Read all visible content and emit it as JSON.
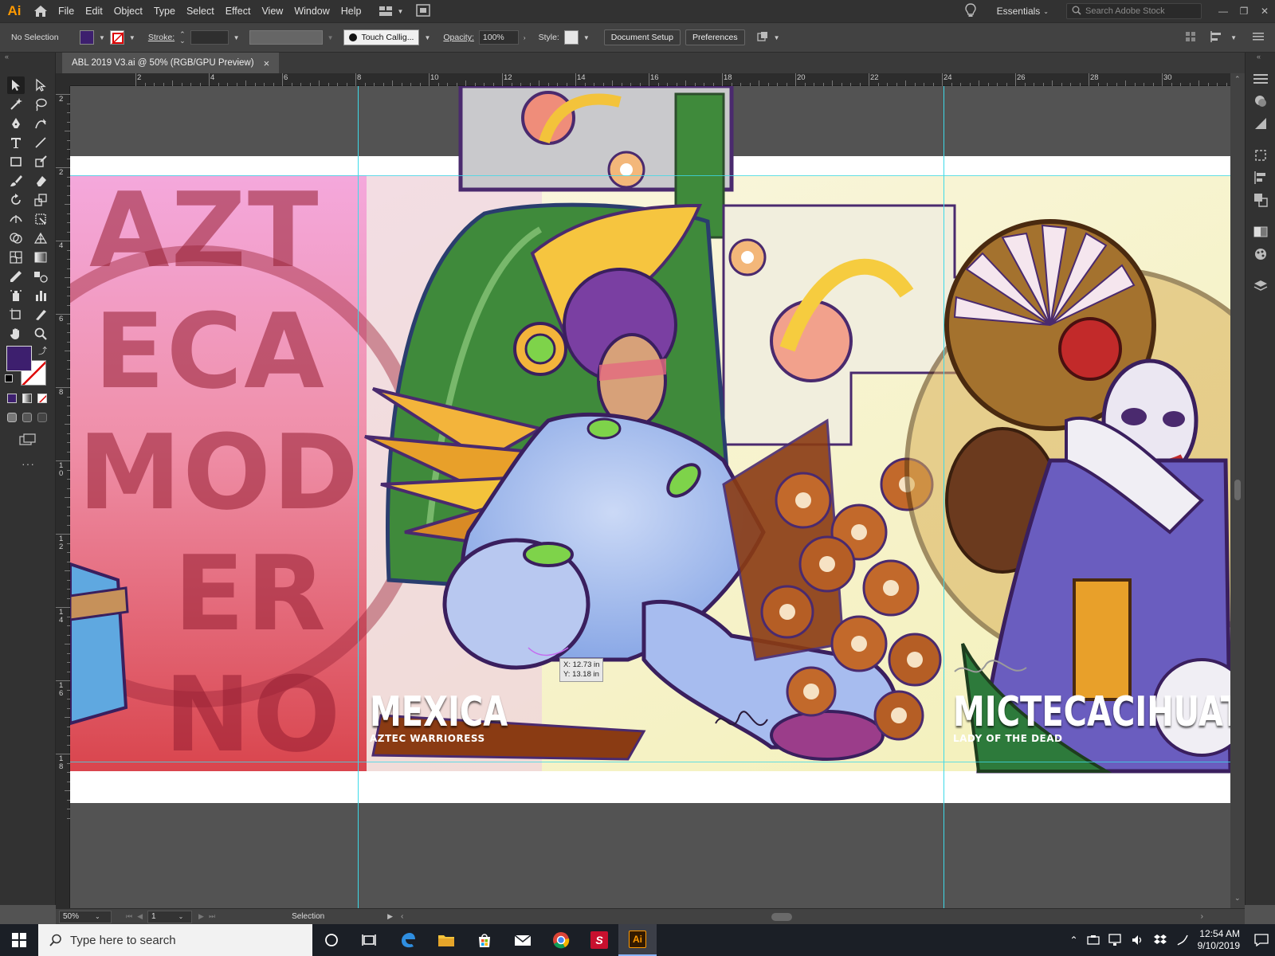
{
  "app": {
    "logo": "Ai",
    "menu": [
      "File",
      "Edit",
      "Object",
      "Type",
      "Select",
      "Effect",
      "View",
      "Window",
      "Help"
    ],
    "workspace": "Essentials",
    "stock_search_placeholder": "Search Adobe Stock"
  },
  "control_bar": {
    "selection_status": "No Selection",
    "fill_color": "#3d1f6e",
    "stroke_label": "Stroke:",
    "brush": "Touch Callig...",
    "opacity_label": "Opacity:",
    "opacity_value": "100%",
    "style_label": "Style:",
    "document_setup": "Document Setup",
    "preferences": "Preferences"
  },
  "document": {
    "tab_title": "ABL 2019 V3.ai @ 50% (RGB/GPU Preview)",
    "close_glyph": "×"
  },
  "rulers": {
    "horizontal_labels": [
      "2",
      "4",
      "6",
      "8",
      "10",
      "12",
      "14",
      "16",
      "18",
      "20",
      "22",
      "24",
      "26",
      "28",
      "30"
    ],
    "vertical_labels": [
      "2",
      "2",
      "4",
      "6",
      "8",
      "1\n0",
      "1\n2",
      "1\n4",
      "1\n6",
      "1\n8"
    ]
  },
  "artwork": {
    "background_words": [
      "AZT",
      "ECA",
      "MOD",
      "ER",
      "NO"
    ],
    "left_caption_title": "MEXICA",
    "left_caption_sub": "AZTEC WARRIORESS",
    "right_caption_title": "MICTECACIHUATL",
    "right_caption_sub": "LADY OF THE DEAD",
    "cursor_readout_x": "X: 12.73 in",
    "cursor_readout_y": "Y: 13.18 in"
  },
  "status_bar": {
    "zoom": "50%",
    "artboard_number": "1",
    "tool_name": "Selection"
  },
  "taskbar": {
    "search_placeholder": "Type here to search",
    "time": "12:54 AM",
    "date": "9/10/2019"
  },
  "colors": {
    "accent_orange": "#ff9a00",
    "guide_cyan": "#3dd9e8",
    "fill_swatch": "#3d1f6e"
  }
}
